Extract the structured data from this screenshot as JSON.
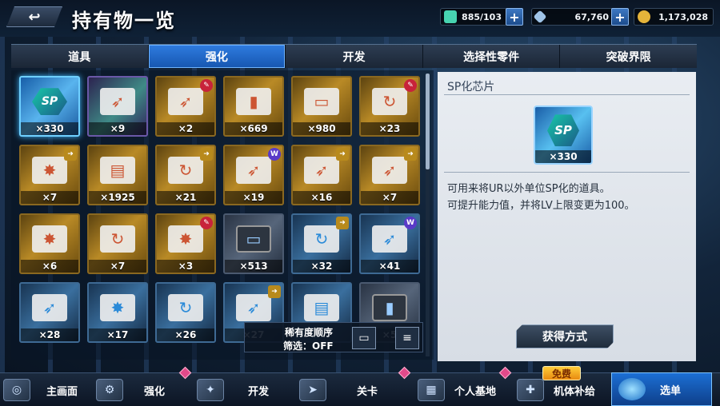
{
  "header": {
    "back_label": "↩",
    "title": "持有物一览",
    "resources": [
      {
        "icon": "energy-icon",
        "value": "885/103",
        "color": "#47d3b0"
      },
      {
        "icon": "diamond-icon",
        "value": "67,760",
        "color": "#9fc4e8"
      },
      {
        "icon": "coin-icon",
        "value": "1,173,028",
        "color": "#e5b43a"
      }
    ],
    "plus_label": "+"
  },
  "tabs": [
    {
      "label": "道具",
      "active": false
    },
    {
      "label": "强化",
      "active": true
    },
    {
      "label": "开发",
      "active": false
    },
    {
      "label": "选择性零件",
      "active": false
    },
    {
      "label": "突破界限",
      "active": false
    }
  ],
  "items": [
    {
      "count": "×330",
      "rarity": "blue",
      "icon": "sp-chip-icon",
      "selected": true
    },
    {
      "count": "×9",
      "rarity": "purple",
      "icon": "arrow-upgrade-icon"
    },
    {
      "count": "×2",
      "rarity": "gold",
      "icon": "arrow-upgrade-icon",
      "badge": "red"
    },
    {
      "count": "×669",
      "rarity": "gold",
      "icon": "memory-card-icon"
    },
    {
      "count": "×980",
      "rarity": "gold",
      "icon": "laptop-icon"
    },
    {
      "count": "×23",
      "rarity": "gold",
      "icon": "swirl-upgrade-icon",
      "badge": "red"
    },
    {
      "count": "×7",
      "rarity": "gold",
      "icon": "burst-upgrade-icon",
      "badge": "gold"
    },
    {
      "count": "×1925",
      "rarity": "gold",
      "icon": "document-stack-icon"
    },
    {
      "count": "×21",
      "rarity": "gold",
      "icon": "swirl-upgrade-icon",
      "badge": "gold"
    },
    {
      "count": "×19",
      "rarity": "gold",
      "icon": "arrow-upgrade-icon",
      "badge": "purple"
    },
    {
      "count": "×16",
      "rarity": "gold",
      "icon": "arrow-upgrade-icon",
      "badge": "gold"
    },
    {
      "count": "×7",
      "rarity": "gold",
      "icon": "arrow-upgrade-icon",
      "badge": "gold"
    },
    {
      "count": "×6",
      "rarity": "gold",
      "icon": "burst-upgrade-icon"
    },
    {
      "count": "×7",
      "rarity": "gold",
      "icon": "swirl-upgrade-icon"
    },
    {
      "count": "×3",
      "rarity": "gold",
      "icon": "burst-upgrade-icon",
      "badge": "red"
    },
    {
      "count": "×513",
      "rarity": "gray",
      "icon": "laptop-icon"
    },
    {
      "count": "×32",
      "rarity": "blue",
      "icon": "swirl-upgrade-icon",
      "badge": "gold"
    },
    {
      "count": "×41",
      "rarity": "blue",
      "icon": "arrow-upgrade-icon",
      "badge": "purple"
    },
    {
      "count": "×28",
      "rarity": "blue",
      "icon": "arrow-upgrade-icon"
    },
    {
      "count": "×17",
      "rarity": "blue",
      "icon": "burst-upgrade-icon"
    },
    {
      "count": "×26",
      "rarity": "blue",
      "icon": "swirl-upgrade-icon"
    },
    {
      "count": "×27",
      "rarity": "blue",
      "icon": "arrow-upgrade-icon",
      "badge": "gold"
    },
    {
      "count": "",
      "rarity": "blue",
      "icon": "document-stack-icon"
    },
    {
      "count": "×5",
      "rarity": "gray",
      "icon": "memory-card-icon"
    }
  ],
  "sort": {
    "order_label": "稀有度顺序",
    "filter_label": "筛选：OFF"
  },
  "detail": {
    "title": "SP化芯片",
    "icon_text": "SP",
    "count": "×330",
    "description_1": "可用来将UR以外单位SP化的道具。",
    "description_2": "可提升能力值，并将LV上限变更为100。",
    "obtain_label": "获得方式"
  },
  "nav": [
    {
      "label": "主画面",
      "icon": "home-icon"
    },
    {
      "label": "强化",
      "icon": "wrench-arm-icon"
    },
    {
      "label": "开发",
      "icon": "dev-hangar-icon"
    },
    {
      "label": "关卡",
      "icon": "rifle-icon"
    },
    {
      "label": "个人基地",
      "icon": "base-icon"
    },
    {
      "label": "机体补给",
      "icon": "supply-icon"
    }
  ],
  "free_badge": "免费",
  "menu_label": "选单"
}
